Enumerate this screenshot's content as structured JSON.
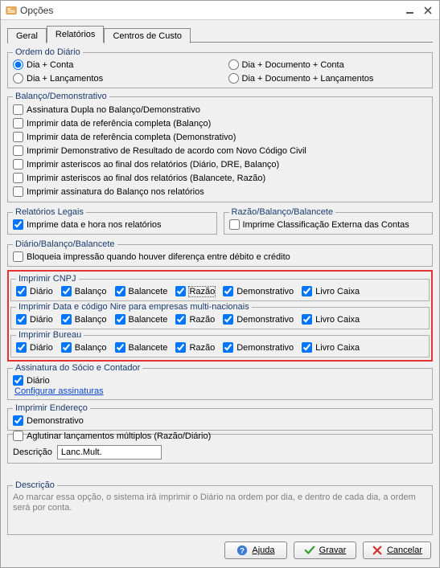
{
  "window": {
    "title": "Opções"
  },
  "tabs": {
    "general": "Geral",
    "reports": "Relatórios",
    "costcenters": "Centros de Custo"
  },
  "ordem": {
    "legend": "Ordem do Diário",
    "opt1": "Dia + Conta",
    "opt2": "Dia + Lançamentos",
    "opt3": "Dia + Documento + Conta",
    "opt4": "Dia + Documento + Lançamentos"
  },
  "balanco": {
    "legend": "Balanço/Demonstrativo",
    "c1": "Assinatura Dupla no Balanço/Demonstrativo",
    "c2": "Imprimir data de referência completa (Balanço)",
    "c3": "Imprimir data de referência completa (Demonstrativo)",
    "c4": "Imprimir Demonstrativo de Resultado de acordo com Novo Código Civil",
    "c5": "Imprimir asteriscos ao final dos relatórios (Diário, DRE, Balanço)",
    "c6": "Imprimir asteriscos ao final dos relatórios (Balancete, Razão)",
    "c7": "Imprimir assinatura do Balanço nos relatórios"
  },
  "legais": {
    "legend": "Relatórios Legais",
    "c1": "Imprime data e hora nos relatórios"
  },
  "razao": {
    "legend": "Razão/Balanço/Balancete",
    "c1": "Imprime Classificação Externa das Contas"
  },
  "dbb": {
    "legend": "Diário/Balanço/Balancete",
    "c1": "Bloqueia impressão quando houver diferença entre débito e crédito"
  },
  "reportCols": {
    "diario": "Diário",
    "balanco": "Balanço",
    "balancete": "Balancete",
    "razao": "Razão",
    "demonstrativo": "Demonstrativo",
    "livrocaixa": "Livro Caixa"
  },
  "cnpj": {
    "legend": "Imprimir CNPJ"
  },
  "nire": {
    "legend": "Imprimir Data e código Nire para empresas multi-nacionais"
  },
  "bureau": {
    "legend": "Imprimir Bureau"
  },
  "assinatura": {
    "legend": "Assinatura do Sócio e Contador",
    "c1": "Diário",
    "link": "Configurar assinaturas"
  },
  "endereco": {
    "legend": "Imprimir Endereço",
    "c1": "Demonstrativo"
  },
  "aglutinar": {
    "label": "Aglutinar lançamentos múltiplos (Razão/Diário)",
    "descLabel": "Descrição",
    "descValue": "Lanc.Mult."
  },
  "descricao": {
    "legend": "Descrição",
    "text": "Ao marcar essa opção, o sistema irá imprimir o Diário na ordem por dia, e dentro de cada dia, a ordem será por conta."
  },
  "buttons": {
    "help": "Ajuda",
    "save": "Gravar",
    "cancel": "Cancelar"
  }
}
